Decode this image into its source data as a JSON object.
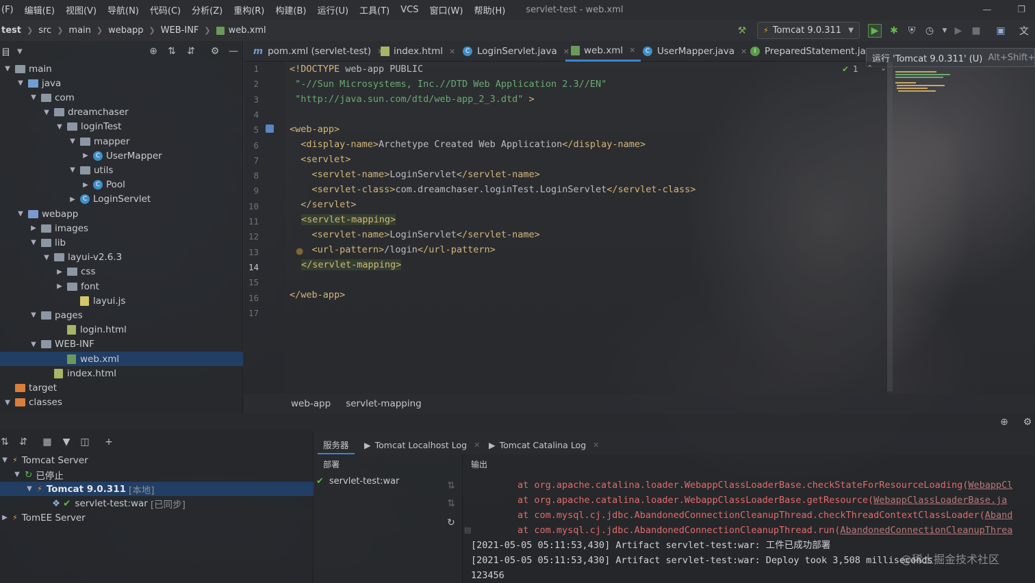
{
  "window": {
    "title": "servlet-test - web.xml"
  },
  "menu": [
    "(F)",
    "编辑(E)",
    "视图(V)",
    "导航(N)",
    "代码(C)",
    "分析(Z)",
    "重构(R)",
    "构建(B)",
    "运行(U)",
    "工具(T)",
    "VCS",
    "窗口(W)",
    "帮助(H)"
  ],
  "breadcrumb": [
    "test",
    "src",
    "main",
    "webapp",
    "WEB-INF",
    "web.xml"
  ],
  "run_config": "Tomcat 9.0.311",
  "tooltip": {
    "text": "运行 'Tomcat 9.0.311' (U)",
    "shortcut": "Alt+Shift+X"
  },
  "project_header": "目",
  "tree": [
    {
      "label": "main",
      "type": "folder"
    },
    {
      "label": "java",
      "type": "folder-blue"
    },
    {
      "label": "com",
      "type": "folder"
    },
    {
      "label": "dreamchaser",
      "type": "folder"
    },
    {
      "label": "loginTest",
      "type": "folder"
    },
    {
      "label": "mapper",
      "type": "folder"
    },
    {
      "label": "UserMapper",
      "type": "class"
    },
    {
      "label": "utils",
      "type": "folder"
    },
    {
      "label": "Pool",
      "type": "class"
    },
    {
      "label": "LoginServlet",
      "type": "class"
    },
    {
      "label": "webapp",
      "type": "folder-web"
    },
    {
      "label": "images",
      "type": "folder"
    },
    {
      "label": "lib",
      "type": "folder"
    },
    {
      "label": "layui-v2.6.3",
      "type": "folder"
    },
    {
      "label": "css",
      "type": "folder"
    },
    {
      "label": "font",
      "type": "folder"
    },
    {
      "label": "layui.js",
      "type": "js"
    },
    {
      "label": "pages",
      "type": "folder"
    },
    {
      "label": "login.html",
      "type": "html"
    },
    {
      "label": "WEB-INF",
      "type": "folder"
    },
    {
      "label": "web.xml",
      "type": "xml"
    },
    {
      "label": "index.html",
      "type": "html"
    },
    {
      "label": "target",
      "type": "folder-orange"
    },
    {
      "label": "classes",
      "type": "folder-orange"
    }
  ],
  "tabs": [
    "pom.xml (servlet-test)",
    "index.html",
    "LoginServlet.java",
    "web.xml",
    "UserMapper.java",
    "PreparedStatement.java"
  ],
  "editor": {
    "line_numbers": [
      "1",
      "2",
      "3",
      "4",
      "5",
      "6",
      "7",
      "8",
      "9",
      "10",
      "11",
      "12",
      "13",
      "14",
      "15",
      "16",
      "17"
    ],
    "inspection_count": "1",
    "lines": {
      "l1a": "<!DOCTYPE",
      "l1b": " web-app PUBLIC",
      "l2": " \"-//Sun Microsystems, Inc.//DTD Web Application 2.3//EN\"",
      "l3a": " \"http://java.sun.com/dtd/web-app_2_3.dtd\"",
      "l3b": " >",
      "l5": "<web-app>",
      "l6a": "  <display-name>",
      "l6b": "Archetype Created Web Application",
      "l6c": "</display-name>",
      "l7": "  <servlet>",
      "l8a": "    <servlet-name>",
      "l8b": "LoginServlet",
      "l8c": "</servlet-name>",
      "l9a": "    <servlet-class>",
      "l9b": "com.dreamchaser.loginTest.LoginServlet",
      "l9c": "</servlet-class>",
      "l10": "  </servlet>",
      "l11": "<servlet-mapping>",
      "l12a": "    <servlet-name>",
      "l12b": "LoginServlet",
      "l12c": "</servlet-name>",
      "l13a": "    <url-pattern>",
      "l13b": "/login",
      "l13c": "</url-pattern>",
      "l14": "</servlet-mapping>",
      "l16": "</web-app>"
    }
  },
  "editor_breadcrumb": [
    "web-app",
    "servlet-mapping"
  ],
  "services": {
    "tree": [
      {
        "label": "Tomcat Server"
      },
      {
        "label": "已停止"
      },
      {
        "label": "Tomcat 9.0.311",
        "tag": "[本地]"
      },
      {
        "label": "servlet-test:war",
        "tag": "[已同步]"
      },
      {
        "label": "TomEE Server"
      }
    ],
    "tabs": [
      "服务器",
      "Tomcat Localhost Log",
      "Tomcat Catalina Log"
    ],
    "deploy_header": "部署",
    "output_header": "输出",
    "deploy_item": "servlet-test:war",
    "output": {
      "o1a": "at org.apache.catalina.loader.WebappClassLoaderBase.checkStateForResourceLoading(",
      "o1b": "WebappCl",
      "o2a": "at org.apache.catalina.loader.WebappClassLoaderBase.getResource(",
      "o2b": "WebappClassLoaderBase.ja",
      "o3a": "at com.mysql.cj.jdbc.AbandonedConnectionCleanupThread.checkThreadContextClassLoader(",
      "o3b": "Aband",
      "o4a": "at com.mysql.cj.jdbc.AbandonedConnectionCleanupThread.run(",
      "o4b": "AbandonedConnectionCleanupThrea",
      "o5": "[2021-05-05 05:11:53,430] Artifact servlet-test:war: 工件已成功部署",
      "o6": "[2021-05-05 05:11:53,430] Artifact servlet-test:war: Deploy took 3,508 milliseconds",
      "o7": "123456"
    },
    "watermark": "@稀土掘金技术社区"
  }
}
